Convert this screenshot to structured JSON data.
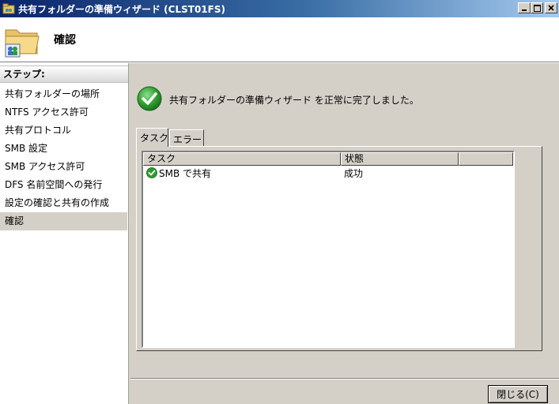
{
  "window": {
    "title": "共有フォルダーの準備ウィザード (CLST01FS)",
    "buttons": {
      "minimize": "_",
      "maximize": "□",
      "close": "X"
    }
  },
  "header": {
    "title": "確認"
  },
  "sidebar": {
    "header": "ステップ:",
    "items": [
      {
        "label": "共有フォルダーの場所"
      },
      {
        "label": "NTFS アクセス許可"
      },
      {
        "label": "共有プロトコル"
      },
      {
        "label": "SMB 設定"
      },
      {
        "label": "SMB アクセス許可"
      },
      {
        "label": "DFS 名前空間への発行"
      },
      {
        "label": "設定の確認と共有の作成"
      },
      {
        "label": "確認"
      }
    ],
    "active_index": 7
  },
  "main": {
    "status_message": "共有フォルダーの準備ウィザード を正常に完了しました。",
    "status_icon": "success-check-icon",
    "tabs": [
      {
        "label": "タスク"
      },
      {
        "label": "エラー"
      }
    ],
    "active_tab": 0,
    "table": {
      "columns": [
        "タスク",
        "状態",
        ""
      ],
      "rows": [
        {
          "task": "SMB で共有",
          "status": "成功",
          "icon": "success-check-icon"
        }
      ]
    }
  },
  "footer": {
    "close_label": "閉じる(C)"
  },
  "colors": {
    "title_start": "#0a246a",
    "title_end": "#a6caf0",
    "success_green": "#2e9b2e",
    "face": "#d4d0c8"
  }
}
